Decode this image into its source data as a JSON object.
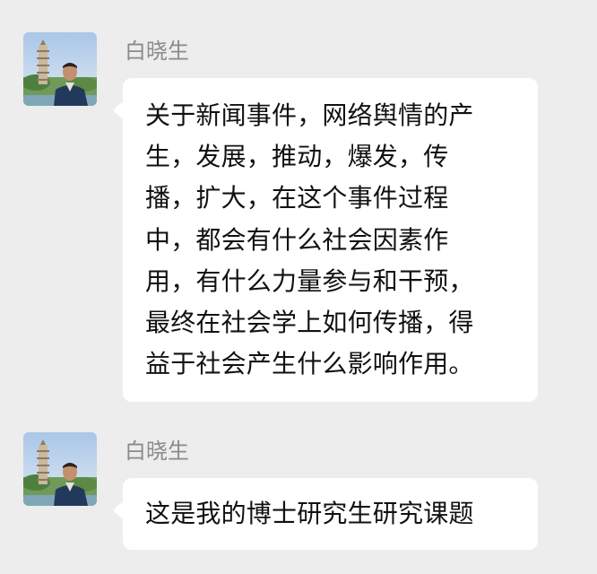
{
  "messages": [
    {
      "sender": "白晓生",
      "lines": [
        "关于新闻事件，网络舆情的产",
        "生，发展，推动，爆发，传",
        "播，扩大，在这个事件过程",
        "中，都会有什么社会因素作",
        "用，有什么力量参与和干预，",
        "最终在社会学上如何传播，得",
        "益于社会产生什么影响作用。"
      ]
    },
    {
      "sender": "白晓生",
      "lines": [
        "这是我的博士研究生研究课题"
      ]
    }
  ]
}
